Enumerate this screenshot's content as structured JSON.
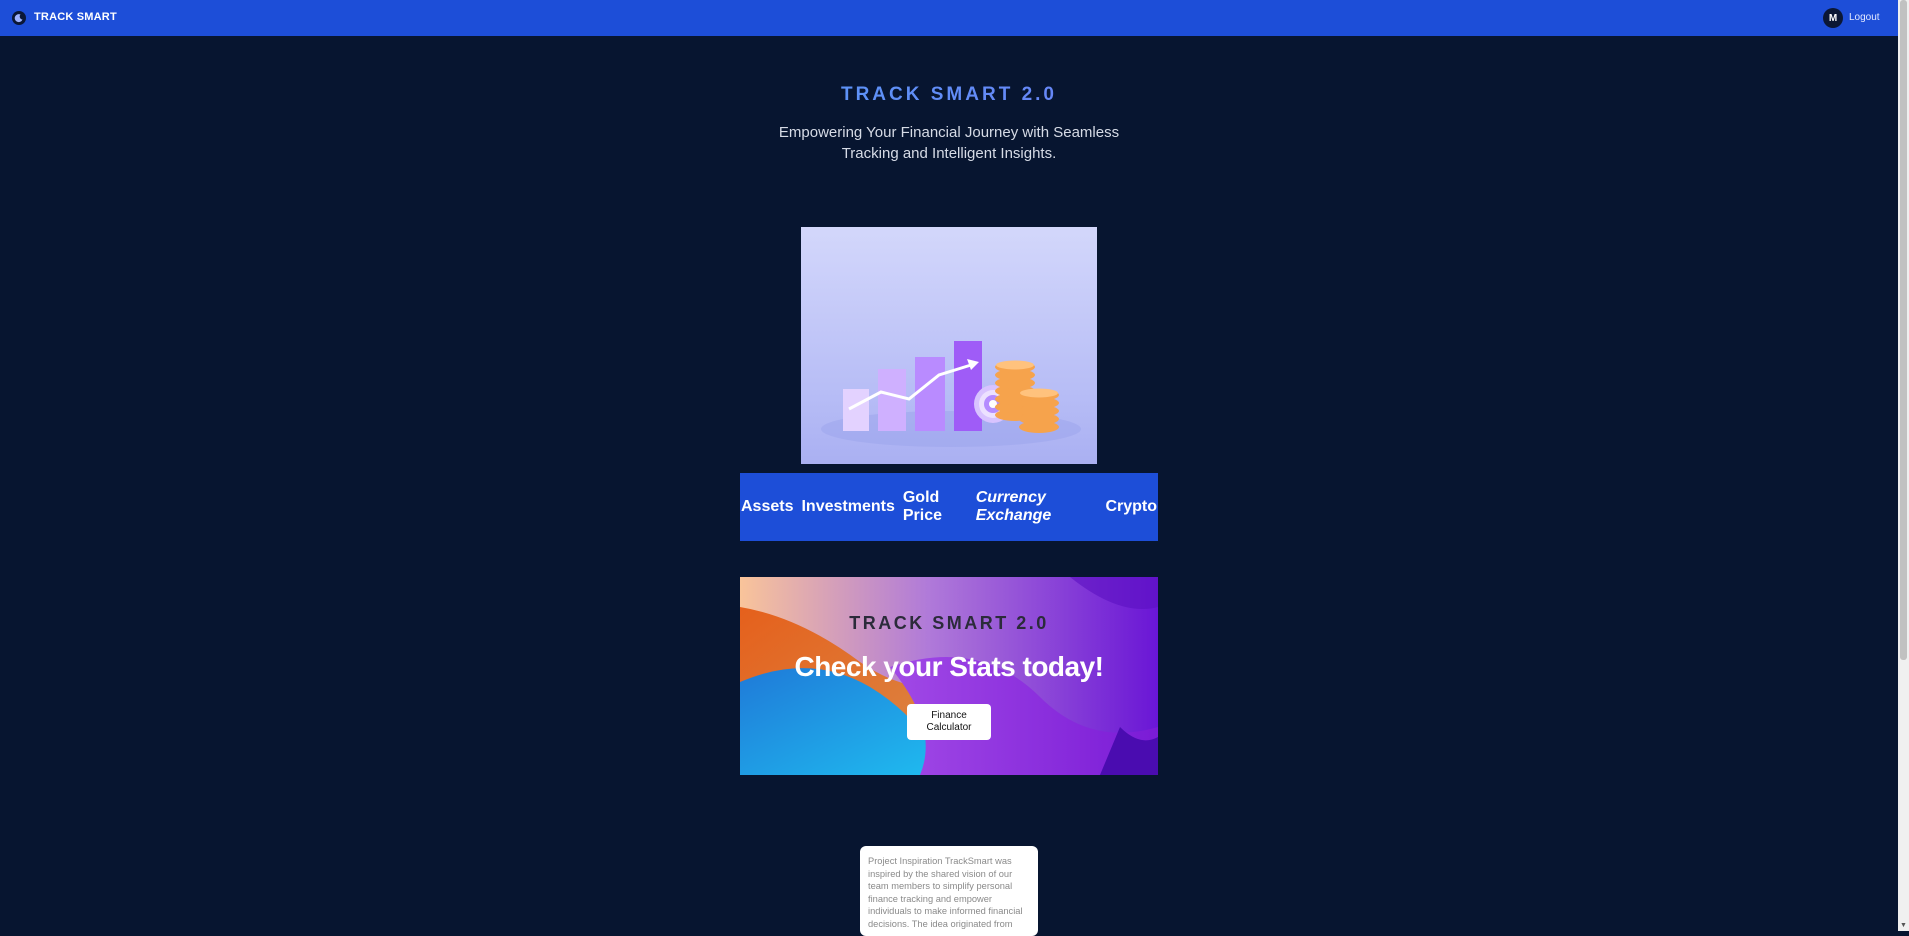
{
  "header": {
    "brand": "TRACK SMART",
    "avatar_initial": "M",
    "logout_label": "Logout"
  },
  "hero": {
    "title": "TRACK SMART 2.0",
    "subtitle": "Empowering Your Financial Journey with Seamless Tracking and Intelligent Insights."
  },
  "nav": {
    "items": [
      {
        "label": "Assets"
      },
      {
        "label": "Investments"
      },
      {
        "label": "Gold Price"
      },
      {
        "label": "Currency Exchange"
      },
      {
        "label": "Crypto"
      }
    ]
  },
  "promo": {
    "title": "TRACK SMART 2.0",
    "headline": "Check your Stats today!",
    "button_label": "Finance Calculator"
  },
  "info_card": {
    "text": "Project Inspiration TrackSmart was inspired by the shared vision of our team members to simplify personal finance tracking and empower individuals to make informed financial decisions. The idea originated from"
  },
  "colors": {
    "header_bg": "#1d4ed8",
    "page_bg": "#071530",
    "nav_bg": "#1d4ed8"
  }
}
